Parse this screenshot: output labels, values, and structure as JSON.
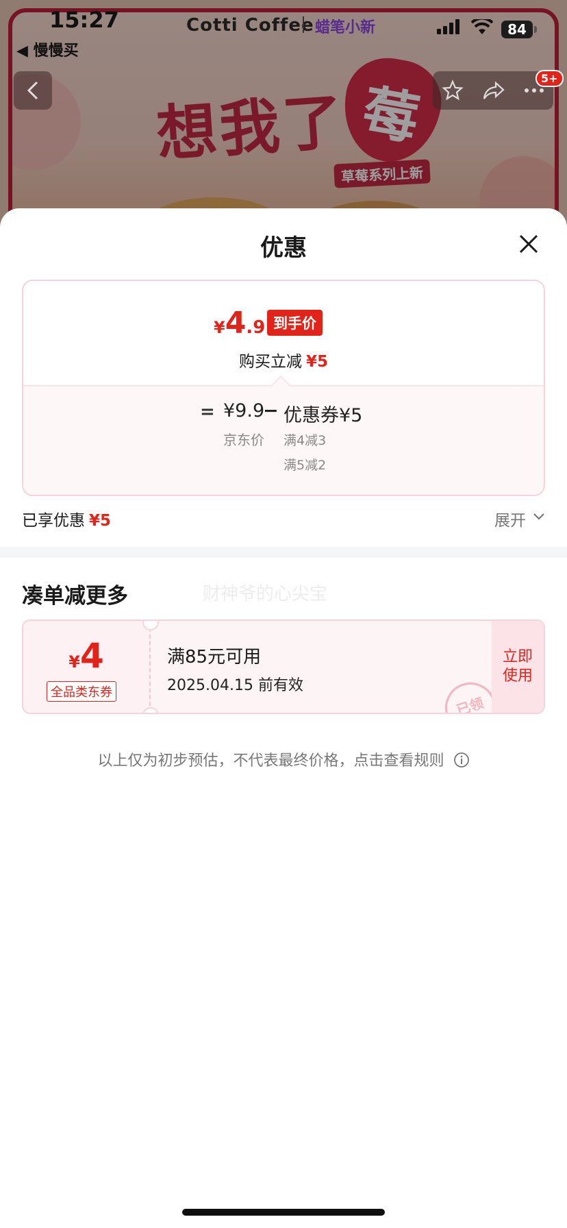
{
  "status_bar": {
    "time": "15:27",
    "battery": "84"
  },
  "app_header": {
    "brand": "Cotti Coffee",
    "collab": "蜡笔小新",
    "back_app": "◀ 慢慢买"
  },
  "banner": {
    "slogan": "想我了",
    "berry_char": "莓",
    "tag": "草莓系列上新"
  },
  "nav": {
    "badge": "5+"
  },
  "sheet": {
    "title": "优惠",
    "final_price": {
      "symbol": "¥",
      "integer": "4",
      "decimal": ".9",
      "tag": "到手价"
    },
    "instant_discount": {
      "label": "购买立减",
      "amount": "¥5"
    },
    "breakdown": {
      "equals": "=",
      "jd_price": "¥9.9",
      "jd_label": "京东价",
      "minus": "−",
      "coupon_total": "优惠券¥5",
      "rules": [
        "满4减3",
        "满5减2"
      ]
    },
    "enjoyed": {
      "label": "已享优惠",
      "amount": "¥5"
    },
    "expand_label": "展开",
    "more_section": {
      "title": "凑单减更多",
      "watermark": "财神爷的心尖宝",
      "coupon": {
        "symbol": "¥",
        "amount": "4",
        "type": "全品类东券",
        "condition": "满85元可用",
        "expire": "2025.04.15 前有效",
        "stamp": "已领",
        "action_line1": "立即",
        "action_line2": "使用"
      }
    },
    "disclaimer": "以上仅为初步预估，不代表最终价格，点击查看规则"
  },
  "colors": {
    "accent": "#e2231a",
    "card_border": "#f8d2da",
    "card_bg": "#fef7f8"
  }
}
